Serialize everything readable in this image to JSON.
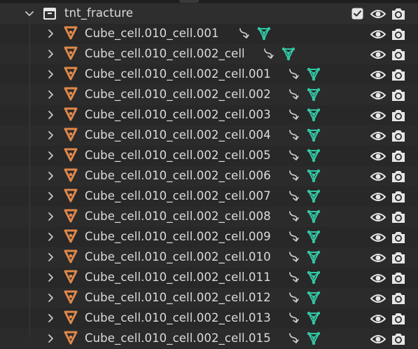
{
  "outliner": {
    "collection": {
      "name": "tnt_fracture",
      "icon": "collection-icon",
      "expanded": true,
      "checked": true
    },
    "items": [
      {
        "name": "Cube_cell.010_cell.001"
      },
      {
        "name": "Cube_cell.010_cell.002_cell"
      },
      {
        "name": "Cube_cell.010_cell.002_cell.001"
      },
      {
        "name": "Cube_cell.010_cell.002_cell.002"
      },
      {
        "name": "Cube_cell.010_cell.002_cell.003"
      },
      {
        "name": "Cube_cell.010_cell.002_cell.004"
      },
      {
        "name": "Cube_cell.010_cell.002_cell.005"
      },
      {
        "name": "Cube_cell.010_cell.002_cell.006"
      },
      {
        "name": "Cube_cell.010_cell.002_cell.007"
      },
      {
        "name": "Cube_cell.010_cell.002_cell.008"
      },
      {
        "name": "Cube_cell.010_cell.002_cell.009"
      },
      {
        "name": "Cube_cell.010_cell.002_cell.010"
      },
      {
        "name": "Cube_cell.010_cell.002_cell.011"
      },
      {
        "name": "Cube_cell.010_cell.002_cell.012"
      },
      {
        "name": "Cube_cell.010_cell.002_cell.013"
      },
      {
        "name": "Cube_cell.010_cell.002_cell.015"
      }
    ],
    "colors": {
      "object_icon": "#e0884a",
      "mesh_icon": "#32c7a4",
      "text": "#dcdcdc",
      "icons": "#e6e6e6"
    }
  }
}
